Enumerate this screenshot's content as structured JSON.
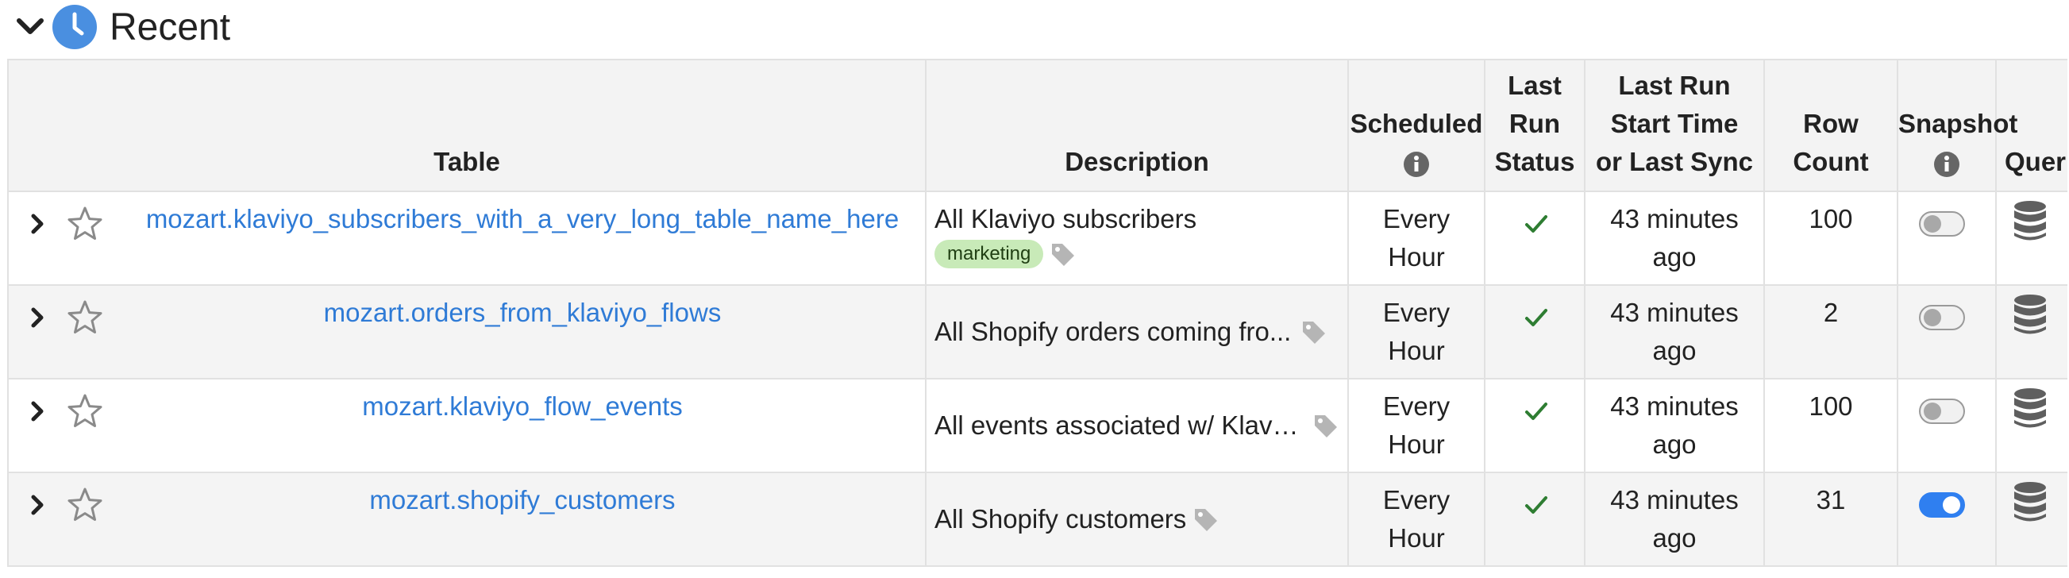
{
  "section": {
    "title": "Recent",
    "collapse_icon": "chevron-down-icon",
    "badge_icon": "clock-icon",
    "accent": "#4a8fe0"
  },
  "columns": {
    "table": "Table",
    "description": "Description",
    "scheduled": "Scheduled",
    "last_run_status": [
      "Last",
      "Run",
      "Status"
    ],
    "last_run_start": [
      "Last Run",
      "Start Time",
      "or Last Sync"
    ],
    "row_count": [
      "Row",
      "Count"
    ],
    "snapshot": "Snapshot",
    "query": "Quer"
  },
  "colors": {
    "link": "#2f7bd6",
    "success": "#2e7d32",
    "toggle_on": "#2f7ff0",
    "tag_bg": "#c8eab8",
    "header_bg": "#f3f3f3"
  },
  "rows": [
    {
      "name": "mozart.klaviyo_subscribers_with_a_very_long_table_name_here",
      "description": "All Klaviyo subscribers",
      "tags": [
        "marketing"
      ],
      "scheduled": [
        "Every",
        "Hour"
      ],
      "status": "success",
      "last_run": [
        "43 minutes",
        "ago"
      ],
      "row_count": "100",
      "snapshot": false
    },
    {
      "name": "mozart.orders_from_klaviyo_flows",
      "description": "All Shopify orders coming fro...",
      "tags": [],
      "scheduled": [
        "Every",
        "Hour"
      ],
      "status": "success",
      "last_run": [
        "43 minutes",
        "ago"
      ],
      "row_count": "2",
      "snapshot": false
    },
    {
      "name": "mozart.klaviyo_flow_events",
      "description": "All events associated w/ Klaviy...",
      "tags": [],
      "scheduled": [
        "Every",
        "Hour"
      ],
      "status": "success",
      "last_run": [
        "43 minutes",
        "ago"
      ],
      "row_count": "100",
      "snapshot": false
    },
    {
      "name": "mozart.shopify_customers",
      "description": "All Shopify customers",
      "tags": [],
      "scheduled": [
        "Every",
        "Hour"
      ],
      "status": "success",
      "last_run": [
        "43 minutes",
        "ago"
      ],
      "row_count": "31",
      "snapshot": true
    }
  ]
}
